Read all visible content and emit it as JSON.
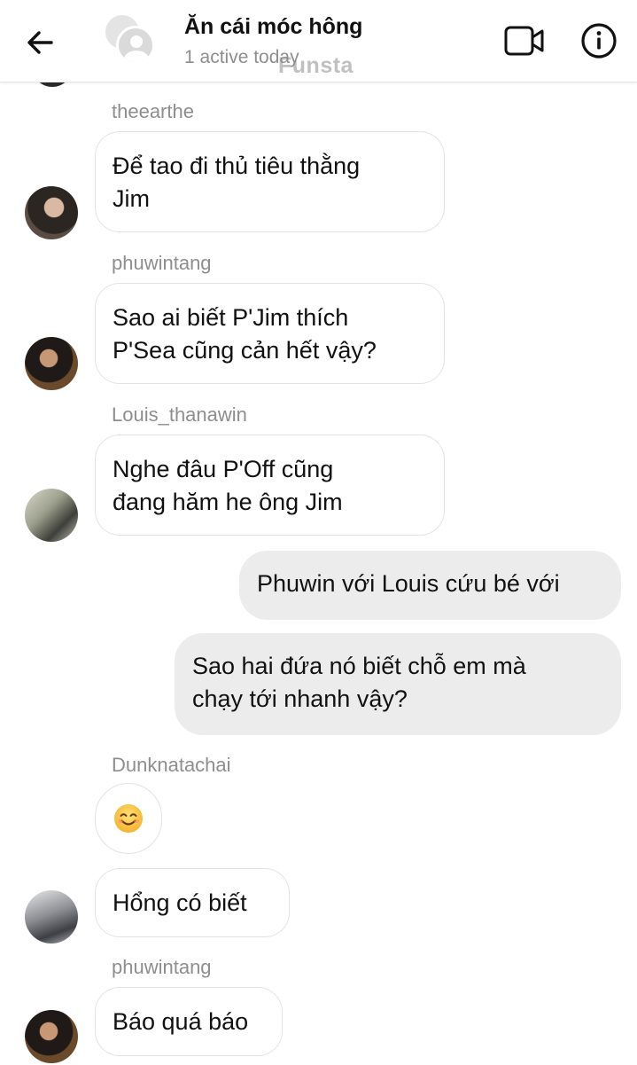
{
  "header": {
    "title": "Ăn cái móc hông",
    "status": "1 active today",
    "watermark": "Funsta",
    "back_icon": "arrow-left-icon",
    "video_icon": "video-camera-icon",
    "info_icon": "info-circle-icon"
  },
  "messages": [
    {
      "sender": "theearthe",
      "text": "Để tao đi thủ tiêu thằng\nJim"
    },
    {
      "sender": "phuwintang",
      "text": "Sao ai biết P'Jim thích\nP'Sea cũng cản hết vậy?"
    },
    {
      "sender": "Louis_thanawin",
      "text": "Nghe đâu P'Off cũng\nđang hăm he ông Jim"
    },
    {
      "sender": "me",
      "text": "Phuwin với Louis cứu bé với"
    },
    {
      "sender": "me",
      "text": "Sao hai đứa nó biết chỗ em mà\nchạy tới nhanh vậy?"
    },
    {
      "sender": "Dunknatachai",
      "text": "😊",
      "emoji_icon": "smiling-face-icon"
    },
    {
      "sender": "Dunknatachai",
      "text": "Hổng có biết"
    },
    {
      "sender": "phuwintang",
      "text": "Báo quá báo"
    }
  ],
  "colors": {
    "outgoing_bubble": "#ececec",
    "incoming_border": "#e3e3e3",
    "secondary_text": "#8e8e8e"
  }
}
